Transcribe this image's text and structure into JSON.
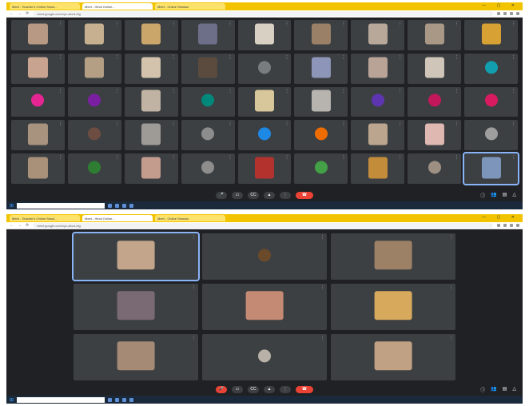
{
  "screenshots": [
    {
      "tabs": [
        "Meet - Teacher's Online Sessi...",
        "Meet - Hindi Online...",
        "Meet - Online Session"
      ],
      "url": "meet.google.com/xyz-abcd-efg",
      "participants": [
        {
          "name": "",
          "type": "video",
          "color": "#b89a84"
        },
        {
          "name": "",
          "type": "video",
          "color": "#c7b08f"
        },
        {
          "name": "",
          "type": "video",
          "color": "#caa66a"
        },
        {
          "name": "",
          "type": "video",
          "color": "#6d6f88"
        },
        {
          "name": "",
          "type": "video",
          "color": "#d8d0c3"
        },
        {
          "name": "",
          "type": "video",
          "color": "#9a8066"
        },
        {
          "name": "",
          "type": "video",
          "color": "#b7a89a"
        },
        {
          "name": "",
          "type": "video",
          "color": "#a99886"
        },
        {
          "name": "",
          "type": "video",
          "color": "#d7a233"
        },
        {
          "name": "",
          "type": "video",
          "color": "#c8a38f"
        },
        {
          "name": "",
          "type": "video",
          "color": "#b59f84"
        },
        {
          "name": "",
          "type": "video",
          "color": "#d3c3ad"
        },
        {
          "name": "",
          "type": "video",
          "color": "#5a4b3e"
        },
        {
          "name": "",
          "type": "avatar",
          "color": "#7a7d80",
          "initial": ""
        },
        {
          "name": "",
          "type": "video",
          "color": "#8d95b8"
        },
        {
          "name": "",
          "type": "video",
          "color": "#b9a396"
        },
        {
          "name": "",
          "type": "video",
          "color": "#cfc6b9"
        },
        {
          "name": "",
          "type": "avatar",
          "color": "#129eaf",
          "initial": ""
        },
        {
          "name": "",
          "type": "avatar",
          "color": "#e52592",
          "initial": ""
        },
        {
          "name": "",
          "type": "avatar",
          "color": "#7b1fa2",
          "initial": ""
        },
        {
          "name": "",
          "type": "video",
          "color": "#c0b3a3"
        },
        {
          "name": "",
          "type": "avatar",
          "color": "#00897b",
          "initial": ""
        },
        {
          "name": "",
          "type": "video",
          "color": "#d8c79b"
        },
        {
          "name": "",
          "type": "video",
          "color": "#b7b3ae"
        },
        {
          "name": "",
          "type": "avatar",
          "color": "#5e35b1",
          "initial": ""
        },
        {
          "name": "",
          "type": "avatar",
          "color": "#c2185b",
          "initial": ""
        },
        {
          "name": "",
          "type": "avatar",
          "color": "#d81b60",
          "initial": ""
        },
        {
          "name": "",
          "type": "video",
          "color": "#a8937f"
        },
        {
          "name": "",
          "type": "avatar",
          "color": "#6d4c41",
          "initial": ""
        },
        {
          "name": "",
          "type": "video",
          "color": "#9e9a96"
        },
        {
          "name": "",
          "type": "avatar",
          "color": "#8d8d8d",
          "initial": ""
        },
        {
          "name": "",
          "type": "avatar",
          "color": "#1e88e5",
          "initial": ""
        },
        {
          "name": "",
          "type": "avatar",
          "color": "#ef6c00",
          "initial": ""
        },
        {
          "name": "",
          "type": "video",
          "color": "#bba58e"
        },
        {
          "name": "",
          "type": "video",
          "color": "#e0b8b2"
        },
        {
          "name": "",
          "type": "avatar",
          "color": "#9e9e9e",
          "initial": ""
        },
        {
          "name": "",
          "type": "video",
          "color": "#a99179"
        },
        {
          "name": "",
          "type": "avatar",
          "color": "#2e7d32",
          "initial": ""
        },
        {
          "name": "",
          "type": "video",
          "color": "#c49c8e"
        },
        {
          "name": "",
          "type": "avatar",
          "color": "#8d8d8d",
          "initial": ""
        },
        {
          "name": "",
          "type": "video",
          "color": "#b3322e"
        },
        {
          "name": "",
          "type": "avatar",
          "color": "#43a047",
          "initial": ""
        },
        {
          "name": "",
          "type": "video",
          "color": "#c28c3a"
        },
        {
          "name": "",
          "type": "avatar",
          "color": "#9e8f83",
          "initial": ""
        },
        {
          "name": "",
          "type": "video",
          "color": "#7d95ba",
          "highlight": true
        }
      ],
      "meeting_info": "",
      "search_placeholder": "",
      "tray_time": ""
    },
    {
      "tabs": [
        "Meet - Teacher's Online Sessi...",
        "Meet - Hindi Online...",
        "Meet - Online Session"
      ],
      "url": "meet.google.com/xyz-abcd-efg",
      "participants": [
        {
          "name": "",
          "type": "video",
          "color": "#c2a58a",
          "highlight": true
        },
        {
          "name": "",
          "type": "avatar",
          "color": "#6b4a2a",
          "initial": ""
        },
        {
          "name": "",
          "type": "video",
          "color": "#9c8166"
        },
        {
          "name": "",
          "type": "video",
          "color": "#7a6a73"
        },
        {
          "name": "",
          "type": "video",
          "color": "#c58a74"
        },
        {
          "name": "",
          "type": "video",
          "color": "#d6a95c"
        },
        {
          "name": "",
          "type": "video",
          "color": "#a58a76"
        },
        {
          "name": "",
          "type": "avatar",
          "color": "#b8b1a7",
          "initial": ""
        },
        {
          "name": "",
          "type": "video",
          "color": "#c1a184"
        }
      ],
      "meeting_info": "",
      "search_placeholder": "",
      "tray_time": ""
    }
  ]
}
